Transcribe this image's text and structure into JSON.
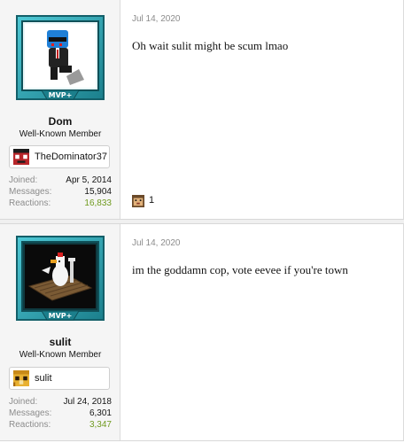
{
  "posts": [
    {
      "date": "Jul 14, 2020",
      "message": "Oh wait sulit might be scum lmao",
      "user": {
        "name": "Dom",
        "title": "Well-Known Member",
        "rank_badge": "MVP+",
        "avatar_icon": "blue-head-suit-character-avatar",
        "mc_name": "TheDominator37",
        "mc_icon": "minecraft-head-icon",
        "stats": [
          {
            "label": "Joined:",
            "value": "Apr 5, 2014"
          },
          {
            "label": "Messages:",
            "value": "15,904"
          },
          {
            "label": "Reactions:",
            "value": "16,833"
          }
        ]
      },
      "reaction": {
        "icon": "reaction-face-icon",
        "count": "1"
      }
    },
    {
      "date": "Jul 14, 2020",
      "message": "im the goddamn cop, vote eevee if you're town",
      "user": {
        "name": "sulit",
        "title": "Well-Known Member",
        "rank_badge": "MVP+",
        "avatar_icon": "chicken-on-raft-avatar",
        "mc_name": "sulit",
        "mc_icon": "minecraft-head-icon",
        "stats": [
          {
            "label": "Joined:",
            "value": "Jul 24, 2018"
          },
          {
            "label": "Messages:",
            "value": "6,301"
          },
          {
            "label": "Reactions:",
            "value": "3,347"
          }
        ]
      }
    }
  ],
  "colors": {
    "frame_teal": "#2ea6b5",
    "reactions_green": "#6f9a1e",
    "muted_gray": "#8c8c8c"
  }
}
